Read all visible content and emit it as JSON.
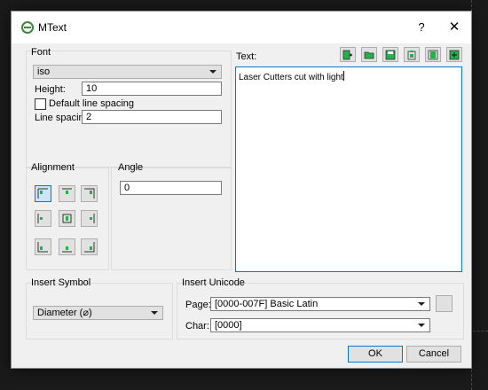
{
  "window": {
    "title": "MText",
    "help_label": "?",
    "close_label": "✕"
  },
  "font": {
    "group_label": "Font",
    "font_name": "iso",
    "height_label": "Height:",
    "height_value": "10",
    "default_line_spacing_label": "Default line spacing",
    "default_line_spacing_checked": false,
    "line_spacing_label": "Line spacing:",
    "line_spacing_value": "2"
  },
  "alignment": {
    "group_label": "Alignment",
    "selected": "top-left"
  },
  "angle": {
    "group_label": "Angle",
    "value": "0"
  },
  "text": {
    "label": "Text:",
    "content": "Laser Cutters cut with light",
    "toolbar": [
      "new-doc-icon",
      "open-folder-icon",
      "save-icon",
      "clipboard-icon",
      "layout-icon",
      "insert-icon"
    ]
  },
  "insert_symbol": {
    "group_label": "Insert Symbol",
    "value": "Diameter (⌀)"
  },
  "insert_unicode": {
    "group_label": "Insert Unicode",
    "page_label": "Page:",
    "page_value": "[0000-007F] Basic Latin",
    "char_label": "Char:",
    "char_value": "[0000]"
  },
  "buttons": {
    "ok": "OK",
    "cancel": "Cancel"
  },
  "colors": {
    "accent": "#0078d7",
    "icon_green": "#22b14c",
    "dialog_bg": "#f0f0f0"
  }
}
